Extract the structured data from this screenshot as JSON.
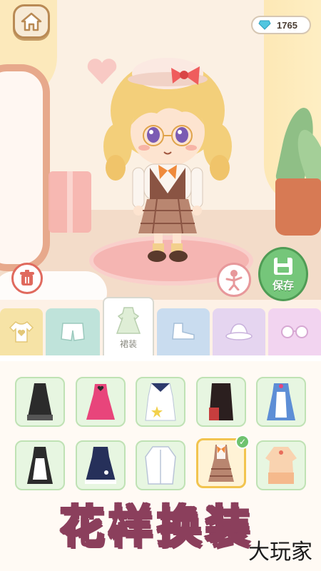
{
  "currency": {
    "gems": "1765",
    "gem_color": "#52c6e0"
  },
  "buttons": {
    "save_label": "保存"
  },
  "tabs": [
    {
      "icon": "top-icon",
      "color": "#f6e3a6",
      "active": false,
      "label": ""
    },
    {
      "icon": "shorts-icon",
      "color": "#bfe3da",
      "active": false,
      "label": ""
    },
    {
      "icon": "dress-icon",
      "color": "#ffffff",
      "active": true,
      "label": "裙装"
    },
    {
      "icon": "shoe-icon",
      "color": "#c9dcef",
      "active": false,
      "label": ""
    },
    {
      "icon": "hat-icon",
      "color": "#e5d5f0",
      "active": false,
      "label": ""
    },
    {
      "icon": "glasses-icon",
      "color": "#f2d4f0",
      "active": false,
      "label": ""
    }
  ],
  "items": [
    {
      "name": "black-gothic-dress",
      "selected": false
    },
    {
      "name": "pink-heart-dress",
      "selected": false
    },
    {
      "name": "sailor-star-dress",
      "selected": false
    },
    {
      "name": "black-red-coat-dress",
      "selected": false
    },
    {
      "name": "blue-apron-dress",
      "selected": false
    },
    {
      "name": "maid-dress",
      "selected": false
    },
    {
      "name": "navy-lace-dress",
      "selected": false
    },
    {
      "name": "white-jacket",
      "selected": false
    },
    {
      "name": "plaid-uniform-dress",
      "selected": true
    },
    {
      "name": "peach-blouse-dress",
      "selected": false
    }
  ],
  "banner": {
    "text": "花样换装"
  },
  "watermark": {
    "text": "大玩家"
  }
}
